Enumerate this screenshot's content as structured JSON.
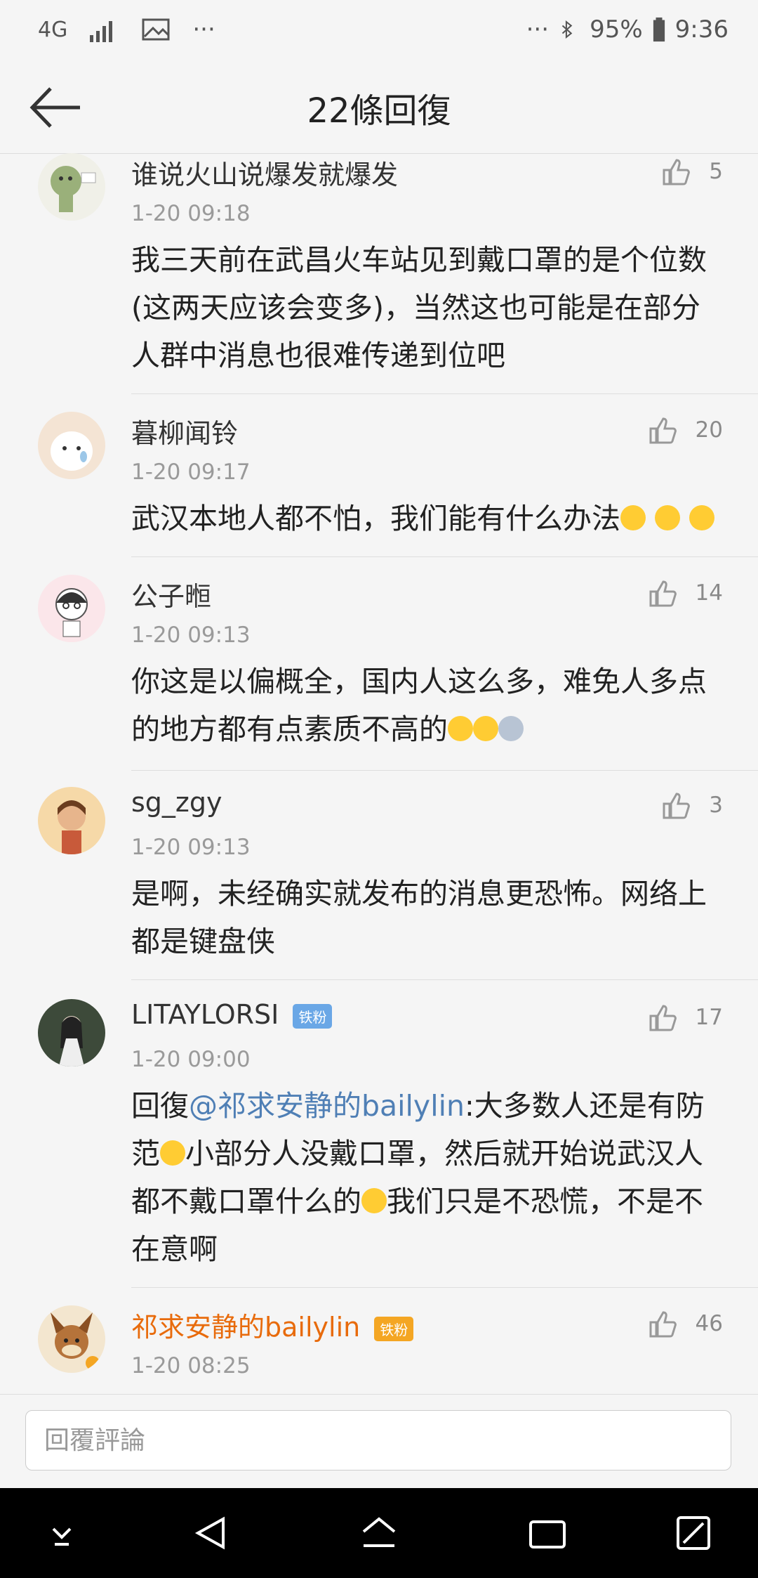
{
  "status_bar": {
    "network": "4G",
    "battery": "95%",
    "time": "9:36",
    "dots": "···"
  },
  "header": {
    "title": "22條回復"
  },
  "comments": [
    {
      "name": "谁说火山说爆发就爆发",
      "time": "1-20 09:18",
      "likes": "5",
      "body": "我三天前在武昌火车站见到戴口罩的是个位数(这两天应该会变多)，当然这也可能是在部分人群中消息也很难传递到位吧"
    },
    {
      "name": "暮柳闻铃",
      "time": "1-20 09:17",
      "likes": "20",
      "body": "武汉本地人都不怕，我们能有什么办法"
    },
    {
      "name": "公子暅",
      "time": "1-20 09:13",
      "likes": "14",
      "body": "你这是以偏概全，国内人这么多，难免人多点的地方都有点素质不高的"
    },
    {
      "name": "sg_zgy",
      "time": "1-20 09:13",
      "likes": "3",
      "body": "是啊，未经确实就发布的消息更恐怖。网络上都是键盘侠"
    },
    {
      "name": "LITAYLORSI",
      "badge": "铁粉",
      "time": "1-20 09:00",
      "likes": "17",
      "reply_prefix": "回復",
      "mention": "@祁求安静的bailylin",
      "body_a": ":大多数人还是有防范",
      "body_b": "小部分人没戴口罩，然后就开始说武汉人都不戴口罩什么的",
      "body_c": "我们只是不恐慌，不是不在意啊"
    },
    {
      "name": "祁求安静的bailylin",
      "badge": "铁粉",
      "time": "1-20 08:25",
      "likes": "46"
    }
  ],
  "reply_bar": {
    "placeholder": "回覆評論"
  },
  "colors": {
    "accent": "#e86b0c",
    "mention": "#4f7fb5",
    "badge": "#6aa7e6"
  }
}
